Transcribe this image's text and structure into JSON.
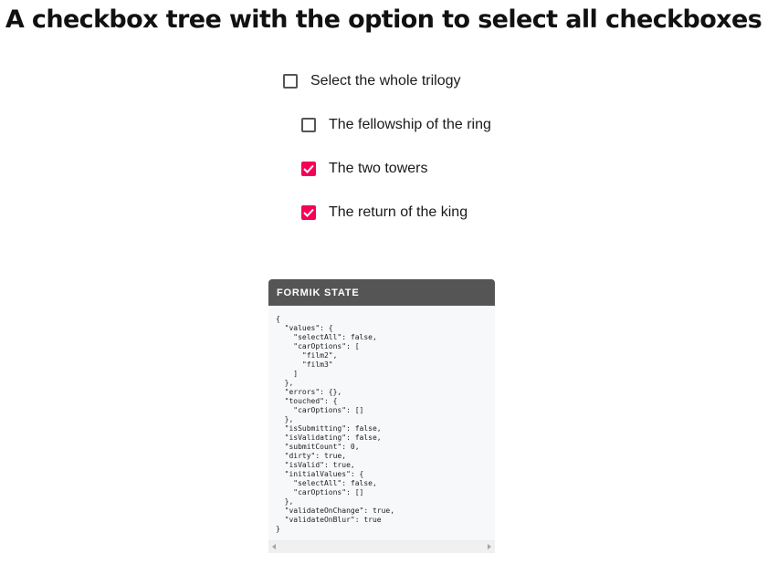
{
  "page": {
    "title": "A checkbox tree with the option to select all checkboxes"
  },
  "checkboxes": {
    "select_all": {
      "label": "Select the whole trilogy",
      "checked": false
    },
    "film1": {
      "label": "The fellowship of the ring",
      "checked": false
    },
    "film2": {
      "label": "The two towers",
      "checked": true
    },
    "film3": {
      "label": "The return of the king",
      "checked": true
    }
  },
  "formik_panel": {
    "header": "FORMIK STATE",
    "state_text": "{\n  \"values\": {\n    \"selectAll\": false,\n    \"carOptions\": [\n      \"film2\",\n      \"film3\"\n    ]\n  },\n  \"errors\": {},\n  \"touched\": {\n    \"carOptions\": []\n  },\n  \"isSubmitting\": false,\n  \"isValidating\": false,\n  \"submitCount\": 0,\n  \"dirty\": true,\n  \"isValid\": true,\n  \"initialValues\": {\n    \"selectAll\": false,\n    \"carOptions\": []\n  },\n  \"validateOnChange\": true,\n  \"validateOnBlur\": true\n}"
  },
  "colors": {
    "accent": "#f50057",
    "panel_header": "#555555",
    "panel_body": "#f6f8fa"
  },
  "icons": {
    "checkmark": "checkmark-icon",
    "scroll_left": "scroll-left-arrow-icon",
    "scroll_right": "scroll-right-arrow-icon"
  }
}
